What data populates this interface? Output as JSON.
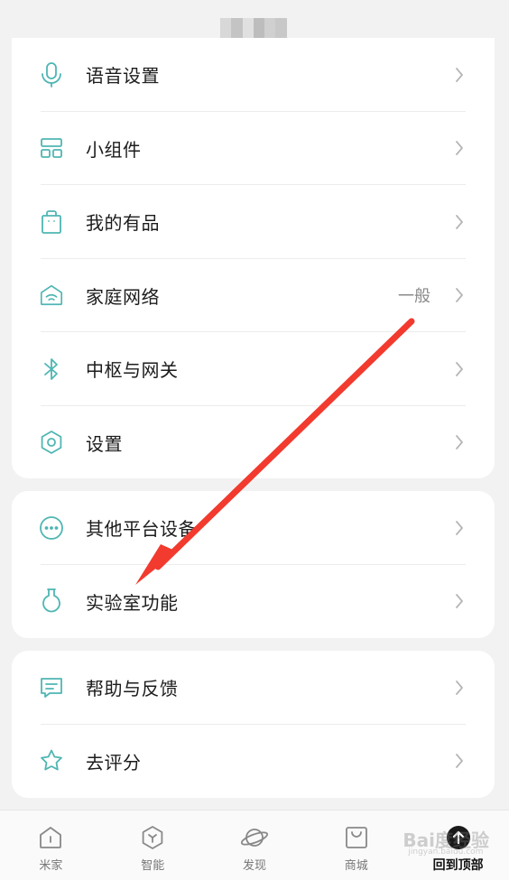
{
  "header": {
    "title_blur_colors": [
      "#d8d8d8",
      "#c4c4c4",
      "#e0e0e0",
      "#bdbdbd",
      "#d0d0d0",
      "#c8c8c8"
    ]
  },
  "colors": {
    "accent": "#4fb6b3",
    "arrow": "#f23a2e",
    "chevron": "#b5b5b5"
  },
  "card1": {
    "items": [
      {
        "label": "语音设置",
        "icon": "microphone-icon"
      },
      {
        "label": "小组件",
        "icon": "widget-grid-icon"
      },
      {
        "label": "我的有品",
        "icon": "shopping-bag-icon"
      },
      {
        "label": "家庭网络",
        "icon": "home-wifi-icon",
        "value": "一般"
      },
      {
        "label": "中枢与网关",
        "icon": "bluetooth-icon"
      },
      {
        "label": "设置",
        "icon": "hexagon-settings-icon"
      }
    ]
  },
  "card2": {
    "items": [
      {
        "label": "其他平台设备",
        "icon": "more-dots-icon"
      },
      {
        "label": "实验室功能",
        "icon": "flask-icon"
      }
    ]
  },
  "card3": {
    "items": [
      {
        "label": "帮助与反馈",
        "icon": "feedback-icon"
      },
      {
        "label": "去评分",
        "icon": "star-icon"
      }
    ]
  },
  "tabbar": {
    "tabs": [
      {
        "label": "米家",
        "icon": "home-icon"
      },
      {
        "label": "智能",
        "icon": "smart-icon"
      },
      {
        "label": "发现",
        "icon": "planet-icon"
      },
      {
        "label": "商城",
        "icon": "shop-bag-icon"
      },
      {
        "label": "回到顶部",
        "icon": "back-to-top-icon"
      }
    ]
  },
  "watermark": {
    "text": "Bai度经验",
    "sub": "jingyan.baidu.com"
  }
}
